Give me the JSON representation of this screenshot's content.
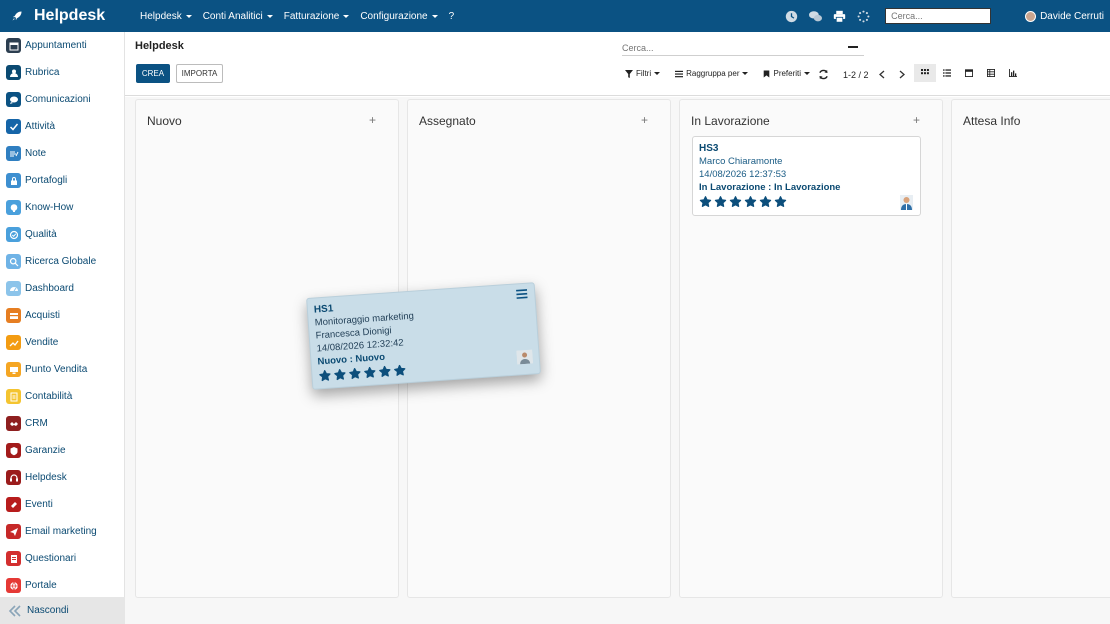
{
  "app": {
    "name": "Helpdesk",
    "search_placeholder": "Cerca...",
    "user": "Davide Cerruti"
  },
  "topmenu": [
    {
      "label": "Helpdesk",
      "dropdown": true
    },
    {
      "label": "Conti Analitici",
      "dropdown": true
    },
    {
      "label": "Fatturazione",
      "dropdown": true
    },
    {
      "label": "Configurazione",
      "dropdown": true
    },
    {
      "label": "?",
      "dropdown": false
    }
  ],
  "sidebar": {
    "items": [
      {
        "label": "Appuntamenti",
        "icon": "calendar-icon",
        "color": "#2c3e50"
      },
      {
        "label": "Rubrica",
        "icon": "contacts-icon",
        "color": "#0b4a72"
      },
      {
        "label": "Comunicazioni",
        "icon": "chat-icon",
        "color": "#0b5283"
      },
      {
        "label": "Attività",
        "icon": "checkbox-icon",
        "color": "#1565a8"
      },
      {
        "label": "Note",
        "icon": "note-icon",
        "color": "#2f7fc1"
      },
      {
        "label": "Portafogli",
        "icon": "lock-icon",
        "color": "#3d8fd0"
      },
      {
        "label": "Know-How",
        "icon": "brain-icon",
        "color": "#4aa0dc"
      },
      {
        "label": "Qualità",
        "icon": "quality-icon",
        "color": "#4aa0dc"
      },
      {
        "label": "Ricerca Globale",
        "icon": "search-icon",
        "color": "#6fb3e6"
      },
      {
        "label": "Dashboard",
        "icon": "dashboard-icon",
        "color": "#8cc4ea"
      },
      {
        "label": "Acquisti",
        "icon": "purchase-icon",
        "color": "#e67e22"
      },
      {
        "label": "Vendite",
        "icon": "sales-icon",
        "color": "#f39c12"
      },
      {
        "label": "Punto Vendita",
        "icon": "pos-icon",
        "color": "#f5a623"
      },
      {
        "label": "Contabilità",
        "icon": "accounting-icon",
        "color": "#f4c430"
      },
      {
        "label": "CRM",
        "icon": "handshake-icon",
        "color": "#8e1f1f"
      },
      {
        "label": "Garanzie",
        "icon": "shield-icon",
        "color": "#a31b1b"
      },
      {
        "label": "Helpdesk",
        "icon": "headset-icon",
        "color": "#9b1c1c"
      },
      {
        "label": "Eventi",
        "icon": "ticket-icon",
        "color": "#b71c1c"
      },
      {
        "label": "Email marketing",
        "icon": "send-icon",
        "color": "#c62828"
      },
      {
        "label": "Questionari",
        "icon": "survey-icon",
        "color": "#d32f2f"
      },
      {
        "label": "Portale",
        "icon": "globe-icon",
        "color": "#e53935"
      }
    ],
    "footer": "Nascondi"
  },
  "control": {
    "breadcrumb": "Helpdesk",
    "search_placeholder": "Cerca...",
    "crea": "CREA",
    "importa": "IMPORTA",
    "filters": [
      "Filtri",
      "Raggruppa per",
      "Preferiti"
    ],
    "pager": "1-2 / 2"
  },
  "kanban": {
    "columns": [
      {
        "title": "Nuovo",
        "add": "+"
      },
      {
        "title": "Assegnato",
        "add": "+"
      },
      {
        "title": "In Lavorazione",
        "add": "+"
      },
      {
        "title": "Attesa Info",
        "add": ""
      }
    ],
    "cards": {
      "hs3": {
        "ref": "HS3",
        "person": "Marco Chiaramonte",
        "date": "14/08/2026 12:37:53",
        "stage": "In Lavorazione : In Lavorazione",
        "stars": 6
      },
      "hs1": {
        "ref": "HS1",
        "title": "Monitoraggio marketing",
        "person": "Francesca Dionigi",
        "date": "14/08/2026 12:32:42",
        "stage": "Nuovo : Nuovo",
        "stars": 6
      }
    }
  },
  "colors": {
    "brand": "#0b5283",
    "link": "#0b4a72",
    "star": "#0d4f7c"
  }
}
